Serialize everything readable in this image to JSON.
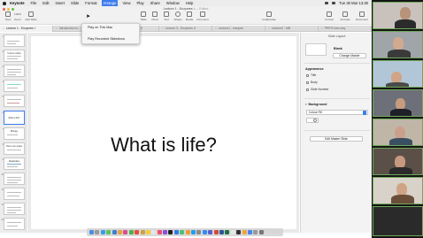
{
  "menubar": {
    "app": "Keynote",
    "items": [
      "File",
      "Edit",
      "Insert",
      "Slide",
      "Format",
      "Arrange",
      "View",
      "Play",
      "Share",
      "Window",
      "Help"
    ],
    "clock": "Tue 30 Mar  13:30"
  },
  "window": {
    "title": "Lecture 1 - Enzymes I",
    "title_suffix": "— Edited"
  },
  "toolbar": {
    "view": "View",
    "zoom": "100%",
    "zoom_label": "Zoom",
    "add_slide": "Add Slide",
    "table": "Table",
    "chart": "Chart",
    "text": "Text",
    "shape": "Shape",
    "media": "Media",
    "comment": "Comment",
    "collaborate": "Collaborate",
    "format": "Format",
    "animate": "Animate",
    "document": "Document"
  },
  "tabs": [
    {
      "label": "Lecture 1 - Enzymes I",
      "active": true
    },
    {
      "label": "Introduction to ...",
      "active": false
    },
    {
      "label": "Lecture 1 - Enzymes II",
      "active": false
    },
    {
      "label": "Lecture 3 - Enzymes II",
      "active": false
    },
    {
      "label": "Lecture1 - enzyme",
      "active": false
    },
    {
      "label": "Lecture2 - MB",
      "active": false
    },
    {
      "label": "PRPG Intro.key",
      "active": false
    }
  ],
  "navigator": {
    "thumbs": [
      {
        "num": "1",
        "title": ""
      },
      {
        "num": "2",
        "title": "Course outline"
      },
      {
        "num": "3",
        "title": ""
      },
      {
        "num": "4",
        "title": ""
      },
      {
        "num": "5",
        "title": ""
      },
      {
        "num": "6",
        "title": "What is life?"
      },
      {
        "num": "7",
        "title": "Biology"
      },
      {
        "num": "8",
        "title": "How to be organised"
      },
      {
        "num": "9",
        "title": "Metabolism"
      },
      {
        "num": "10",
        "title": ""
      },
      {
        "num": "11",
        "title": ""
      },
      {
        "num": "12",
        "title": ""
      },
      {
        "num": "13",
        "title": ""
      }
    ]
  },
  "slide": {
    "title": "What is life?"
  },
  "inspector": {
    "header": "Slide Layout",
    "theme": "Blank",
    "change_master": "Change Master",
    "appearance": "Appearance",
    "title_check": "Title",
    "body_check": "Body",
    "slide_number_check": "Slide Number",
    "background": "Background",
    "fill_label": "Colour Fill",
    "edit_master": "Edit Master Slide"
  },
  "play_menu": {
    "items": [
      "Play on This Mac",
      "Play Recorded Slideshow"
    ]
  },
  "colors": {
    "accent": "#3d7cf0",
    "tile_border": "#6fa85b"
  }
}
